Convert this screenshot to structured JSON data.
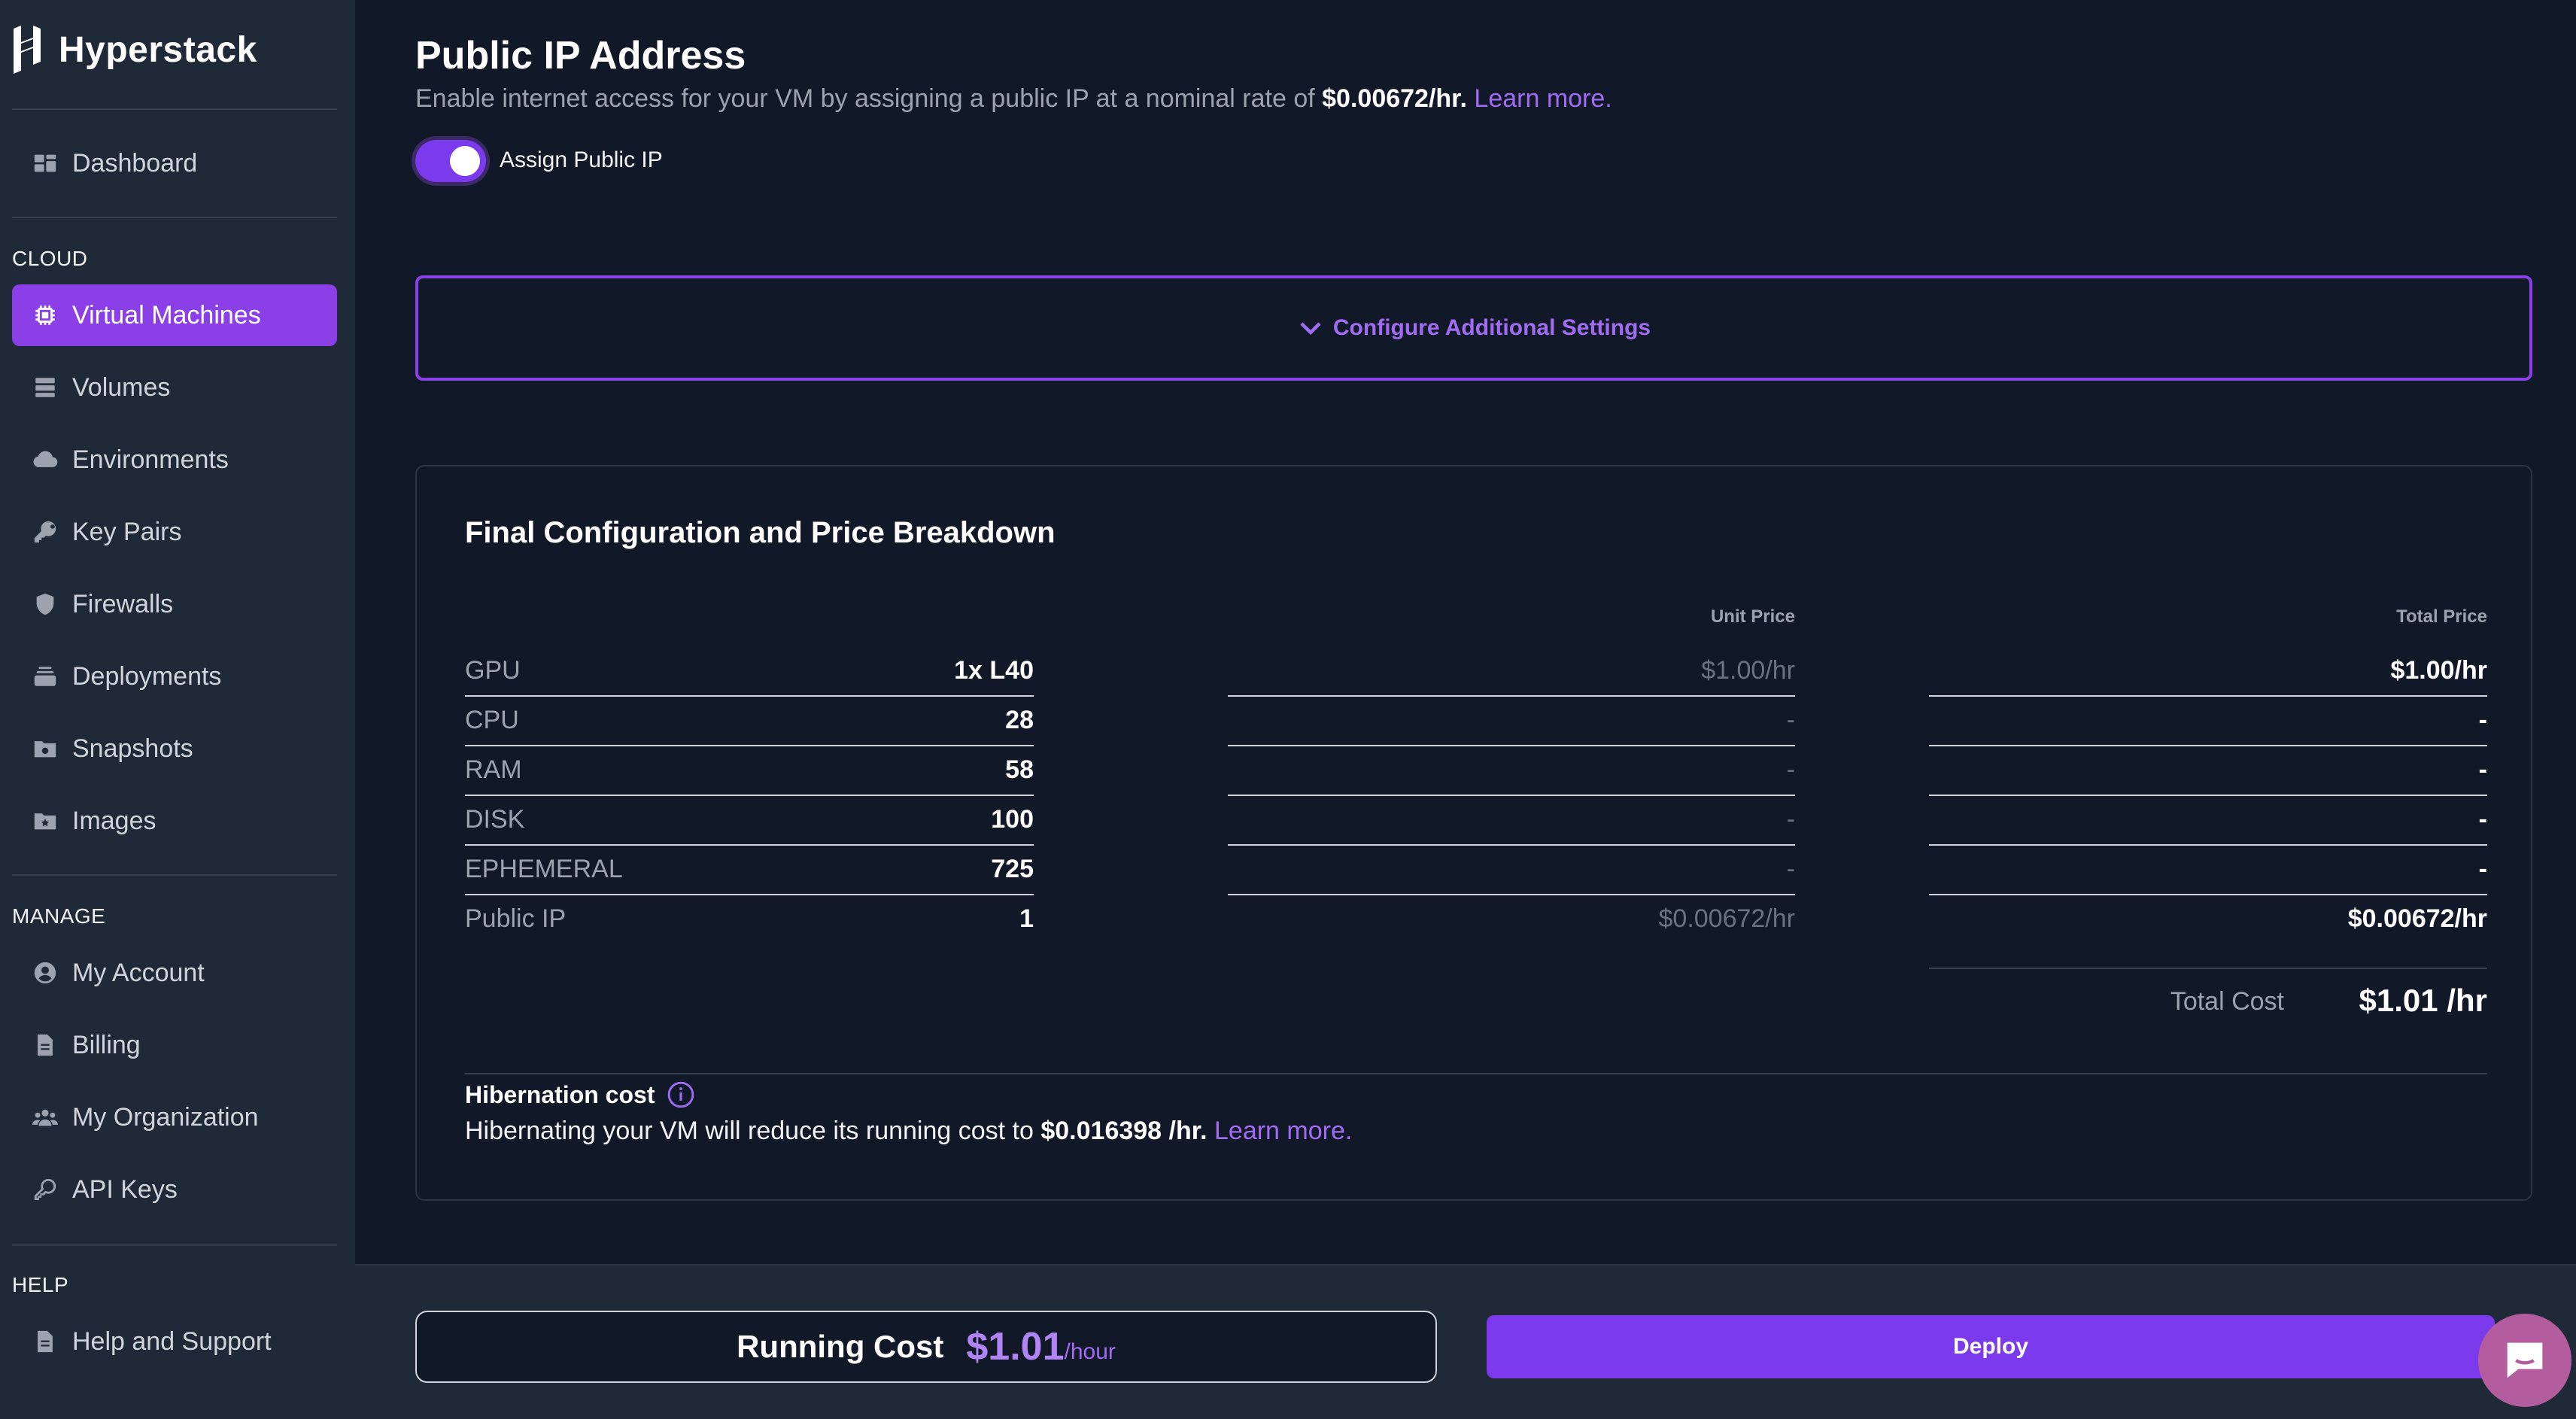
{
  "brand": {
    "name": "Hyperstack"
  },
  "sidebar": {
    "dashboard": {
      "label": "Dashboard",
      "icon": "dashboard-icon"
    },
    "cloud_label": "CLOUD",
    "cloud_items": [
      {
        "label": "Virtual Machines",
        "icon": "chip-icon",
        "active": true
      },
      {
        "label": "Volumes",
        "icon": "database-icon"
      },
      {
        "label": "Environments",
        "icon": "cloud-icon"
      },
      {
        "label": "Key Pairs",
        "icon": "key-icon"
      },
      {
        "label": "Firewalls",
        "icon": "shield-icon"
      },
      {
        "label": "Deployments",
        "icon": "layers-icon"
      },
      {
        "label": "Snapshots",
        "icon": "camera-folder-icon"
      },
      {
        "label": "Images",
        "icon": "image-folder-icon"
      }
    ],
    "manage_label": "MANAGE",
    "manage_items": [
      {
        "label": "My Account",
        "icon": "user-circle-icon"
      },
      {
        "label": "Billing",
        "icon": "document-icon"
      },
      {
        "label": "My Organization",
        "icon": "users-icon"
      },
      {
        "label": "API Keys",
        "icon": "key-outline-icon"
      }
    ],
    "help_label": "HELP",
    "help_items": [
      {
        "label": "Help and Support",
        "icon": "document-icon"
      }
    ]
  },
  "public_ip": {
    "title": "Public IP Address",
    "desc_prefix": "Enable internet access for your VM by assigning a public IP at a nominal rate of ",
    "rate": "$0.00672/hr.",
    "learn_more": "Learn more.",
    "toggle_label": "Assign Public IP",
    "toggle_on": true
  },
  "additional_settings": {
    "label": "Configure Additional Settings"
  },
  "breakdown": {
    "title": "Final Configuration and Price Breakdown",
    "unit_price_header": "Unit Price",
    "total_price_header": "Total Price",
    "rows": [
      {
        "label": "GPU",
        "value": "1x L40",
        "unit_price": "$1.00/hr",
        "total_price": "$1.00/hr"
      },
      {
        "label": "CPU",
        "value": "28",
        "unit_price": "-",
        "total_price": "-"
      },
      {
        "label": "RAM",
        "value": "58",
        "unit_price": "-",
        "total_price": "-"
      },
      {
        "label": "DISK",
        "value": "100",
        "unit_price": "-",
        "total_price": "-"
      },
      {
        "label": "EPHEMERAL",
        "value": "725",
        "unit_price": "-",
        "total_price": "-"
      },
      {
        "label": "Public IP",
        "value": "1",
        "unit_price": "$0.00672/hr",
        "total_price": "$0.00672/hr"
      }
    ],
    "total_label": "Total Cost",
    "total_value": "$1.01 /hr",
    "hibernation": {
      "title": "Hibernation cost",
      "text_prefix": "Hibernating your VM will reduce its running cost to ",
      "rate": "$0.016398 /hr.",
      "learn_more": "Learn more."
    }
  },
  "footer": {
    "running_label": "Running Cost",
    "running_value": "$1.01",
    "running_unit": "/hour",
    "deploy_label": "Deploy"
  },
  "colors": {
    "accent": "#8b3fe6",
    "background": "#111827",
    "sidebar": "#1f2937"
  }
}
